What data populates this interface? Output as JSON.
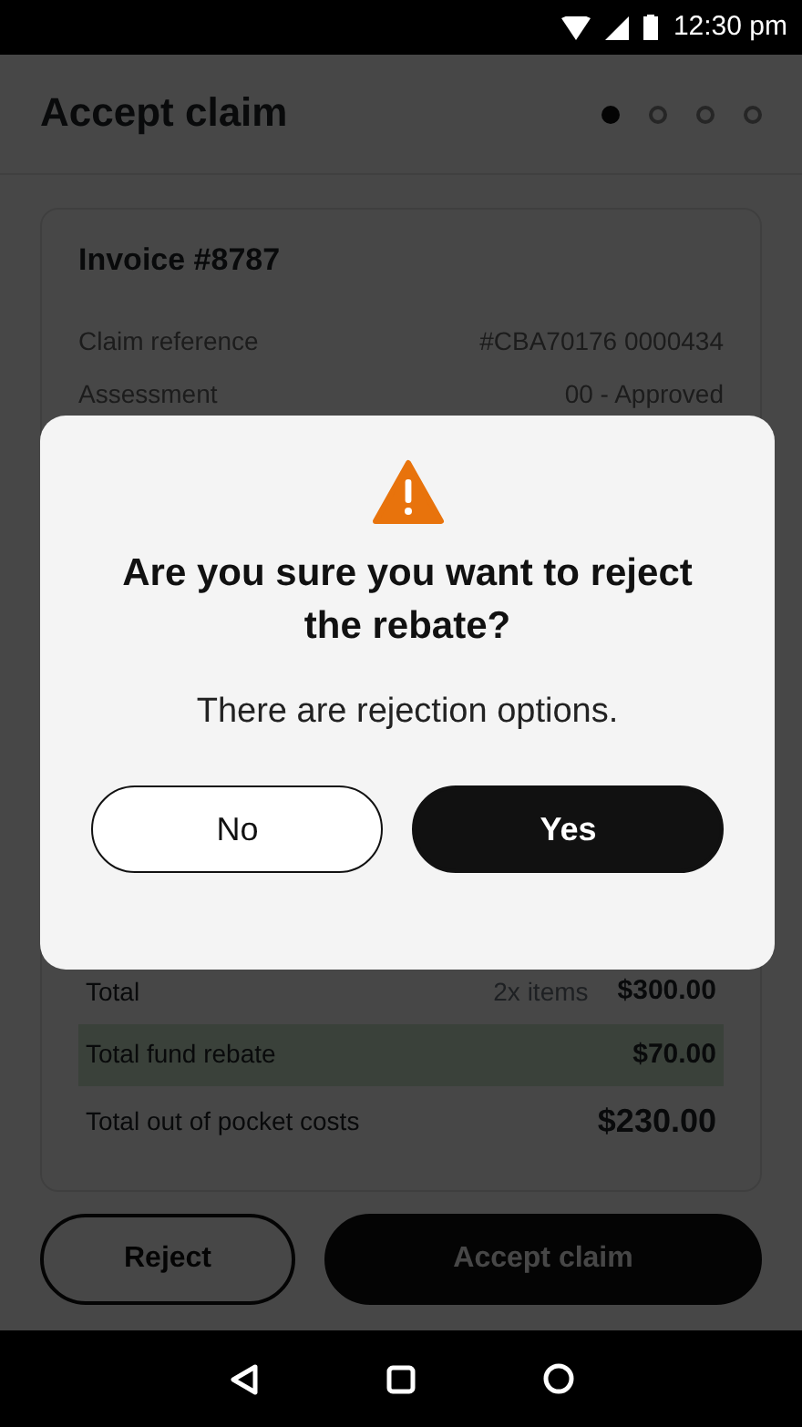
{
  "status_bar": {
    "time": "12:30 pm"
  },
  "header": {
    "title": "Accept claim"
  },
  "steps": [
    {
      "selected": true
    },
    {
      "selected": false
    },
    {
      "selected": false
    },
    {
      "selected": false
    }
  ],
  "invoice": {
    "title": "Invoice #8787",
    "details": [
      {
        "label": "Claim reference",
        "value": "#CBA70176 0000434"
      },
      {
        "label": "Assessment",
        "value": "00 - Approved"
      }
    ],
    "totals": [
      {
        "label": "Total",
        "note": "2x items",
        "value": "$300.00",
        "highlighted": false,
        "large": false
      },
      {
        "label": "Total fund rebate",
        "value": "$70.00",
        "highlighted": true,
        "large": false
      },
      {
        "label": "Total out of pocket costs",
        "value": "$230.00",
        "highlighted": false,
        "large": true
      }
    ]
  },
  "actions": [
    {
      "label": "Reject",
      "kind": "outline"
    },
    {
      "label": "Accept claim",
      "kind": "solid"
    }
  ],
  "dialog": {
    "title": "Are you sure you want to reject the rebate?",
    "message": "There are rejection options.",
    "buttons": [
      {
        "label": "No",
        "kind": "outline"
      },
      {
        "label": "Yes",
        "kind": "solid"
      }
    ]
  }
}
